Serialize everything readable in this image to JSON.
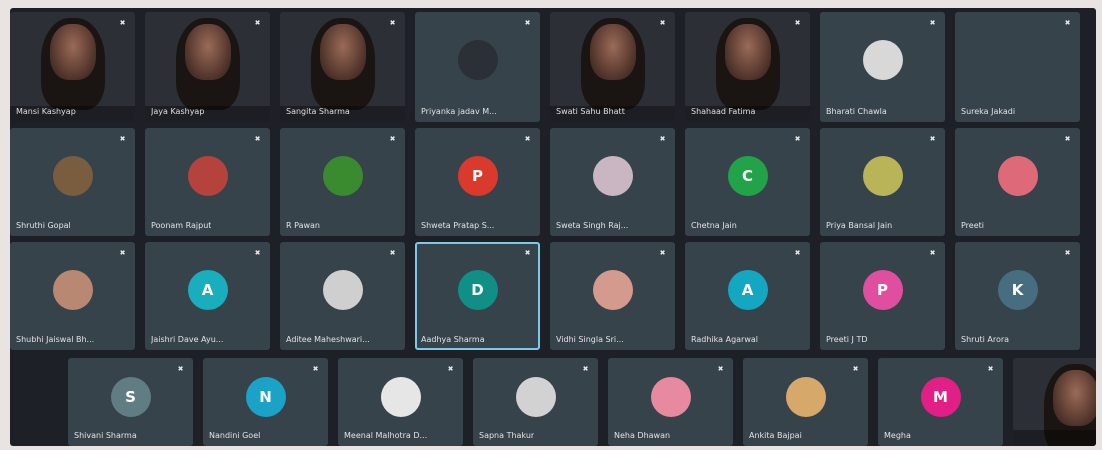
{
  "colors": {
    "screen_bg": "#1d2026",
    "tile_bg": "#37434b",
    "speaking_border": "#7fc9e8"
  },
  "icons": {
    "mic": "mic-muted-icon"
  },
  "tiles": [
    {
      "name": "Mansi Kashyap",
      "kind": "video",
      "avatar": ""
    },
    {
      "name": "Jaya Kashyap",
      "kind": "video",
      "avatar": ""
    },
    {
      "name": "Sangita Sharma",
      "kind": "video",
      "avatar": ""
    },
    {
      "name": "Priyanka jadav M...",
      "kind": "avatar",
      "avatar": "",
      "avatar_color": "#2b2f36"
    },
    {
      "name": "Swati Sahu Bhatt",
      "kind": "video",
      "avatar": ""
    },
    {
      "name": "Shahaad Fatima",
      "kind": "video",
      "avatar": ""
    },
    {
      "name": "Bharati Chawla",
      "kind": "avatar",
      "avatar": "",
      "avatar_color": "#d8d8d8"
    },
    {
      "name": "Sureka Jakadi",
      "kind": "avatar",
      "avatar": "",
      "avatar_color": ""
    },
    {
      "name": "Shruthi Gopal",
      "kind": "avatar",
      "avatar": "",
      "avatar_color": "#7a5d3e"
    },
    {
      "name": "Poonam Rajput",
      "kind": "avatar",
      "avatar": "",
      "avatar_color": "#b3433c"
    },
    {
      "name": "R Pawan",
      "kind": "avatar",
      "avatar": "",
      "avatar_color": "#3a8a2f"
    },
    {
      "name": "Shweta Pratap S...",
      "kind": "avatar",
      "avatar": "P",
      "avatar_color": "#d93a2b"
    },
    {
      "name": "Sweta Singh Raj...",
      "kind": "avatar",
      "avatar": "",
      "avatar_color": "#c9b6c2"
    },
    {
      "name": "Chetna Jain",
      "kind": "avatar",
      "avatar": "C",
      "avatar_color": "#22a34a"
    },
    {
      "name": "Priya Bansal Jain",
      "kind": "avatar",
      "avatar": "",
      "avatar_color": "#b8b457"
    },
    {
      "name": "Preeti",
      "kind": "avatar",
      "avatar": "",
      "avatar_color": "#de6a79"
    },
    {
      "name": "Shubhi Jaiswal Bh...",
      "kind": "avatar",
      "avatar": "",
      "avatar_color": "#b88872"
    },
    {
      "name": "Jaishri Dave Ayu...",
      "kind": "avatar",
      "avatar": "A",
      "avatar_color": "#18aebd"
    },
    {
      "name": "Aditee Maheshwari...",
      "kind": "avatar",
      "avatar": "",
      "avatar_color": "#cfcfcf"
    },
    {
      "name": "Aadhya Sharma",
      "kind": "avatar",
      "avatar": "D",
      "avatar_color": "#0f8f86",
      "speaking": true
    },
    {
      "name": "Vidhi Singla Sri...",
      "kind": "avatar",
      "avatar": "",
      "avatar_color": "#d59a8e"
    },
    {
      "name": "Radhika Agarwal",
      "kind": "avatar",
      "avatar": "A",
      "avatar_color": "#13a7c2"
    },
    {
      "name": "Preeti J TD",
      "kind": "avatar",
      "avatar": "P",
      "avatar_color": "#e04f9f"
    },
    {
      "name": "Shruti Arora",
      "kind": "avatar",
      "avatar": "K",
      "avatar_color": "#466e80"
    },
    {
      "name": "Shivani Sharma",
      "kind": "avatar",
      "avatar": "S",
      "avatar_color": "#5f7d83"
    },
    {
      "name": "Nandini Goel",
      "kind": "avatar",
      "avatar": "N",
      "avatar_color": "#1aa2c7"
    },
    {
      "name": "Meenal Malhotra D...",
      "kind": "avatar",
      "avatar": "",
      "avatar_color": "#e6e6e6"
    },
    {
      "name": "Sapna Thakur",
      "kind": "avatar",
      "avatar": "",
      "avatar_color": "#d2d2d2"
    },
    {
      "name": "Neha Dhawan",
      "kind": "avatar",
      "avatar": "",
      "avatar_color": "#e78aa0"
    },
    {
      "name": "Ankita Bajpai",
      "kind": "avatar",
      "avatar": "",
      "avatar_color": "#d6a96a"
    },
    {
      "name": "Megha",
      "kind": "avatar",
      "avatar": "M",
      "avatar_color": "#e11f86"
    },
    {
      "name": "",
      "kind": "video",
      "avatar": ""
    }
  ]
}
